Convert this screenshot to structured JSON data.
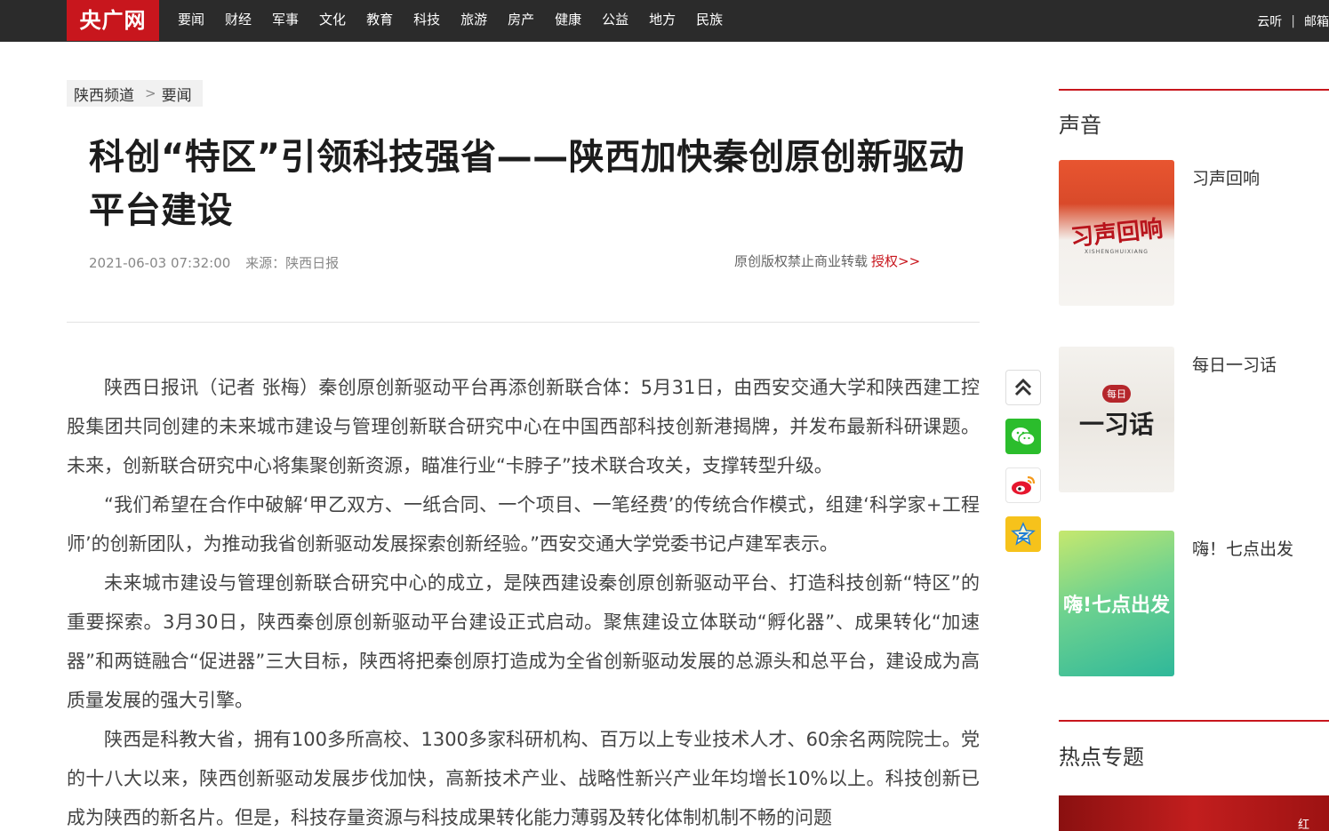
{
  "topbar": {
    "logo": "央广网",
    "nav": [
      "要闻",
      "财经",
      "军事",
      "文化",
      "教育",
      "科技",
      "旅游",
      "房产",
      "健康",
      "公益",
      "地方",
      "民族"
    ],
    "right_links": [
      "云听",
      "邮箱"
    ],
    "background": "#2b2b2b",
    "logo_color": "#c8161d"
  },
  "breadcrumb": {
    "channel": "陕西频道",
    "arrow": ">",
    "section": "要闻"
  },
  "article": {
    "title": "科创“特区”引领科技强省——陕西加快秦创原创新驱动平台建设",
    "date": "2021-06-03 07:32:00",
    "source_label": "来源：",
    "source": "陕西日报",
    "copyright": "原创版权禁止商业转载",
    "authorize_link": "授权>>",
    "paragraphs": [
      "陕西日报讯（记者 张梅）秦创原创新驱动平台再添创新联合体：5月31日，由西安交通大学和陕西建工控股集团共同创建的未来城市建设与管理创新联合研究中心在中国西部科技创新港揭牌，并发布最新科研课题。未来，创新联合研究中心将集聚创新资源，瞄准行业“卡脖子”技术联合攻关，支撑转型升级。",
      "“我们希望在合作中破解‘甲乙双方、一纸合同、一个项目、一笔经费’的传统合作模式，组建‘科学家+工程师’的创新团队，为推动我省创新驱动发展探索创新经验。”西安交通大学党委书记卢建军表示。",
      "未来城市建设与管理创新联合研究中心的成立，是陕西建设秦创原创新驱动平台、打造科技创新“特区”的重要探索。3月30日，陕西秦创原创新驱动平台建设正式启动。聚焦建设立体联动“孵化器”、成果转化“加速器”和两链融合“促进器”三大目标，陕西将把秦创原打造成为全省创新驱动发展的总源头和总平台，建设成为高质量发展的强大引擎。",
      "陕西是科教大省，拥有100多所高校、1300多家科研机构、百万以上专业技术人才、60余名两院院士。党的十八大以来，陕西创新驱动发展步伐加快，高新技术产业、战略性新兴产业年均增长10%以上。科技创新已成为陕西的新名片。但是，科技存量资源与科技成果转化能力薄弱及转化体制机制不畅的问题"
    ]
  },
  "share": {
    "icons": [
      "scroll-top-icon",
      "wechat-icon",
      "weibo-icon",
      "qzone-icon"
    ]
  },
  "sidebar": {
    "audio_title": "声音",
    "audio_items": [
      {
        "name": "习声回响",
        "thumb_text": "习声回响",
        "thumb_sub": "XISHENGHUIXIANG"
      },
      {
        "name": "每日一习话",
        "thumb_text": "一习话",
        "thumb_badge": "每日"
      },
      {
        "name": "嗨！七点出发",
        "thumb_text": "嗨!七点出发"
      }
    ],
    "hot_title": "热点专题",
    "hot_banner_tag": "红",
    "accent": "#c8161d"
  }
}
